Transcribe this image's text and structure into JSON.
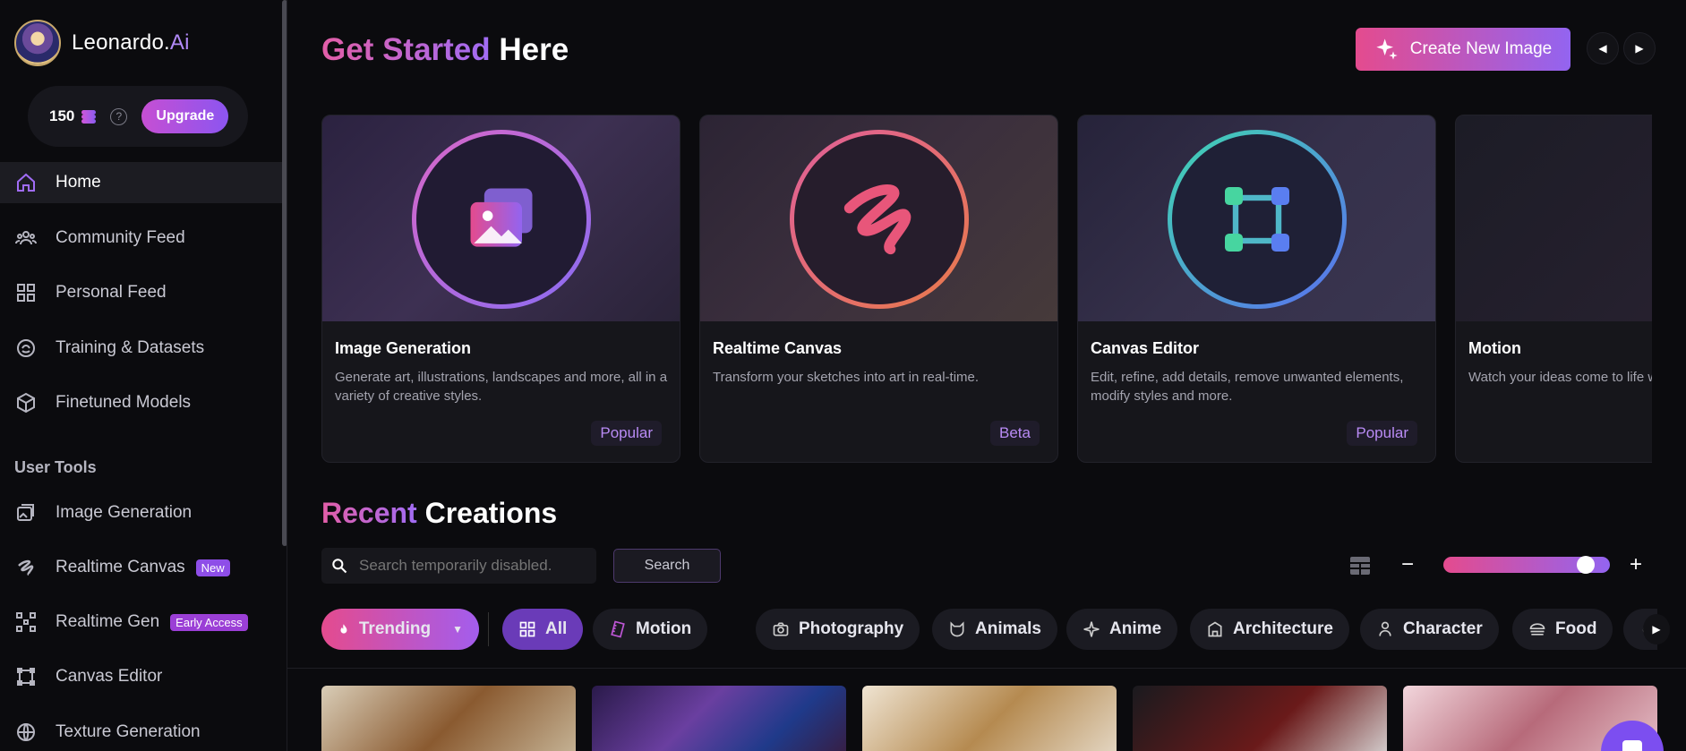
{
  "app": {
    "brand_main": "Leonardo.",
    "brand_accent": "Ai"
  },
  "credits": {
    "count": "150",
    "help": "?",
    "upgrade_label": "Upgrade"
  },
  "nav": {
    "main": [
      {
        "label": "Home",
        "icon": "home-icon",
        "active": true
      },
      {
        "label": "Community Feed",
        "icon": "users-icon"
      },
      {
        "label": "Personal Feed",
        "icon": "grid-icon"
      },
      {
        "label": "Training & Datasets",
        "icon": "training-icon"
      },
      {
        "label": "Finetuned Models",
        "icon": "cube-icon"
      }
    ],
    "section_title": "User Tools",
    "tools": [
      {
        "label": "Image Generation",
        "icon": "images-icon"
      },
      {
        "label": "Realtime Canvas",
        "icon": "brush-icon",
        "tag": "New"
      },
      {
        "label": "Realtime Gen",
        "icon": "realtime-gen-icon",
        "tag": "Early Access"
      },
      {
        "label": "Canvas Editor",
        "icon": "canvas-icon"
      },
      {
        "label": "Texture Generation",
        "icon": "texture-icon"
      }
    ]
  },
  "header": {
    "title_accent": "Get Started",
    "title_rest": "Here",
    "create_label": "Create New Image"
  },
  "cards": [
    {
      "title": "Image Generation",
      "desc": "Generate art, illustrations, landscapes and more, all in a variety of creative styles.",
      "badge": "Popular"
    },
    {
      "title": "Realtime Canvas",
      "desc": "Transform your sketches into art in real-time.",
      "badge": "Beta"
    },
    {
      "title": "Canvas Editor",
      "desc": "Edit, refine, add details, remove unwanted elements, modify styles and more.",
      "badge": "Popular"
    },
    {
      "title": "Motion",
      "desc": "Watch your ideas come to life with generative video.",
      "badge": ""
    }
  ],
  "recent": {
    "title_accent": "Recent",
    "title_rest": "Creations",
    "search_placeholder": "Search temporarily disabled.",
    "search_button": "Search",
    "zoom_minus": "−",
    "zoom_plus": "+",
    "zoom_level": 0.9
  },
  "chips": [
    {
      "label": "Trending",
      "icon": "fire-icon"
    },
    {
      "label": "All",
      "icon": "grid-icon"
    },
    {
      "label": "Motion",
      "icon": "film-icon"
    },
    {
      "label": "Photography",
      "icon": "camera-icon"
    },
    {
      "label": "Animals",
      "icon": "cat-icon"
    },
    {
      "label": "Anime",
      "icon": "sparkle-icon"
    },
    {
      "label": "Architecture",
      "icon": "building-icon"
    },
    {
      "label": "Character",
      "icon": "person-icon"
    },
    {
      "label": "Food",
      "icon": "burger-icon"
    }
  ],
  "colors": {
    "accent_pink": "#e44b8e",
    "accent_purple": "#9364f0",
    "background": "#0b0b0e"
  }
}
